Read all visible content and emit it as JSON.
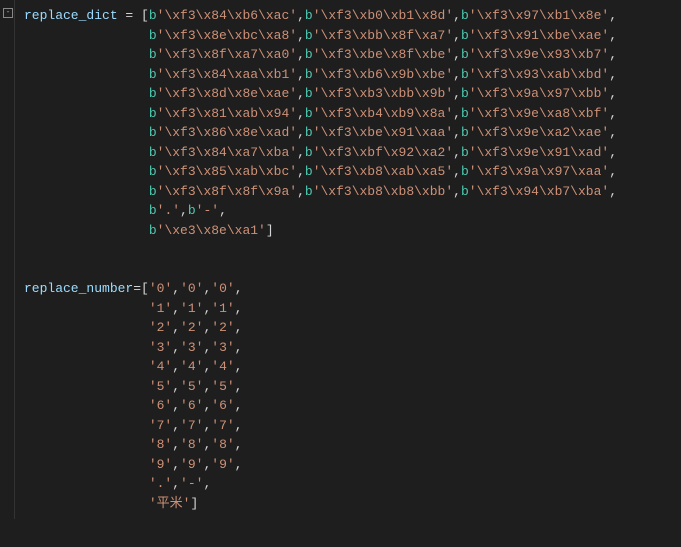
{
  "code": {
    "var1_name": "replace_dict",
    "eq": "=",
    "dict_rows": [
      [
        "'\\xf3\\x84\\xb6\\xac'",
        "'\\xf3\\xb0\\xb1\\x8d'",
        "'\\xf3\\x97\\xb1\\x8e'"
      ],
      [
        "'\\xf3\\x8e\\xbc\\xa8'",
        "'\\xf3\\xbb\\x8f\\xa7'",
        "'\\xf3\\x91\\xbe\\xae'"
      ],
      [
        "'\\xf3\\x8f\\xa7\\xa0'",
        "'\\xf3\\xbe\\x8f\\xbe'",
        "'\\xf3\\x9e\\x93\\xb7'"
      ],
      [
        "'\\xf3\\x84\\xaa\\xb1'",
        "'\\xf3\\xb6\\x9b\\xbe'",
        "'\\xf3\\x93\\xab\\xbd'"
      ],
      [
        "'\\xf3\\x8d\\x8e\\xae'",
        "'\\xf3\\xb3\\xbb\\x9b'",
        "'\\xf3\\x9a\\x97\\xbb'"
      ],
      [
        "'\\xf3\\x81\\xab\\x94'",
        "'\\xf3\\xb4\\xb9\\x8a'",
        "'\\xf3\\x9e\\xa8\\xbf'"
      ],
      [
        "'\\xf3\\x86\\x8e\\xad'",
        "'\\xf3\\xbe\\x91\\xaa'",
        "'\\xf3\\x9e\\xa2\\xae'"
      ],
      [
        "'\\xf3\\x84\\xa7\\xba'",
        "'\\xf3\\xbf\\x92\\xa2'",
        "'\\xf3\\x9e\\x91\\xad'"
      ],
      [
        "'\\xf3\\x85\\xab\\xbc'",
        "'\\xf3\\xb8\\xab\\xa5'",
        "'\\xf3\\x9a\\x97\\xaa'"
      ],
      [
        "'\\xf3\\x8f\\x8f\\x9a'",
        "'\\xf3\\xb8\\xb8\\xbb'",
        "'\\xf3\\x94\\xb7\\xba'"
      ]
    ],
    "dict_extra": [
      "'.'",
      "'-'"
    ],
    "dict_last": "'\\xe3\\x8e\\xa1'",
    "var2_name": "replace_number",
    "num_rows": [
      [
        "'0'",
        "'0'",
        "'0'"
      ],
      [
        "'1'",
        "'1'",
        "'1'"
      ],
      [
        "'2'",
        "'2'",
        "'2'"
      ],
      [
        "'3'",
        "'3'",
        "'3'"
      ],
      [
        "'4'",
        "'4'",
        "'4'"
      ],
      [
        "'5'",
        "'5'",
        "'5'"
      ],
      [
        "'6'",
        "'6'",
        "'6'"
      ],
      [
        "'7'",
        "'7'",
        "'7'"
      ],
      [
        "'8'",
        "'8'",
        "'8'"
      ],
      [
        "'9'",
        "'9'",
        "'9'"
      ]
    ],
    "num_extra": [
      "'.'",
      "'-'"
    ],
    "num_last": "'平米'"
  }
}
